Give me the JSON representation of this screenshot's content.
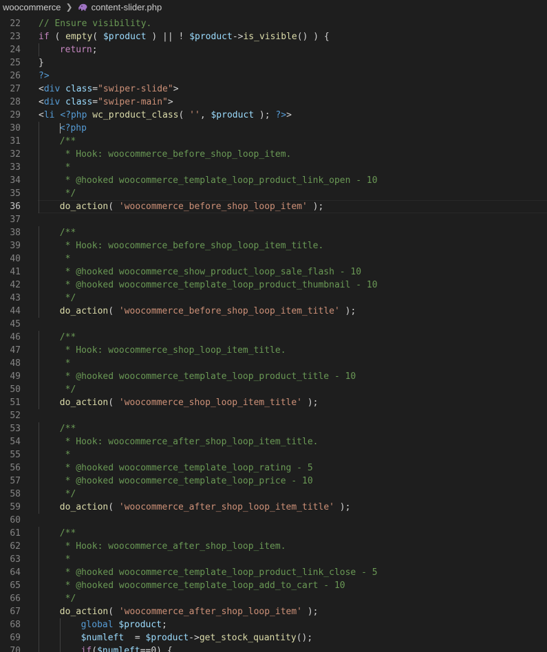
{
  "breadcrumb": {
    "folder": "woocommerce",
    "file": "content-slider.php",
    "file_icon": "php-elephant-icon"
  },
  "colors": {
    "background": "#1e1e1e",
    "comment": "#6a9955",
    "keyword": "#c586c0",
    "variable": "#9cdcfe",
    "function": "#dcdcaa",
    "string": "#ce9178",
    "tag": "#569cd6",
    "plain": "#d4d4d4"
  },
  "editor": {
    "current_line": 36,
    "lines": [
      {
        "n": "22",
        "indent": 0,
        "tokens": [
          [
            "c",
            "// Ensure visibility."
          ]
        ]
      },
      {
        "n": "23",
        "indent": 0,
        "tokens": [
          [
            "k",
            "if"
          ],
          [
            "p",
            " ( "
          ],
          [
            "f",
            "empty"
          ],
          [
            "p",
            "( "
          ],
          [
            "v",
            "$product"
          ],
          [
            "p",
            " ) || ! "
          ],
          [
            "v",
            "$product"
          ],
          [
            "p",
            "->"
          ],
          [
            "f",
            "is_visible"
          ],
          [
            "p",
            "() ) {"
          ]
        ]
      },
      {
        "n": "24",
        "indent": 1,
        "tokens": [
          [
            "k",
            "return"
          ],
          [
            "p",
            ";"
          ]
        ]
      },
      {
        "n": "25",
        "indent": 0,
        "tokens": [
          [
            "p",
            "}"
          ]
        ]
      },
      {
        "n": "26",
        "indent": 0,
        "tokens": [
          [
            "t",
            "?>"
          ]
        ]
      },
      {
        "n": "27",
        "indent": 0,
        "tokens": [
          [
            "p",
            "<"
          ],
          [
            "t",
            "div"
          ],
          [
            "p",
            " "
          ],
          [
            "a",
            "class"
          ],
          [
            "p",
            "="
          ],
          [
            "s",
            "\"swiper-slide\""
          ],
          [
            "p",
            ">"
          ]
        ]
      },
      {
        "n": "28",
        "indent": 0,
        "tokens": [
          [
            "p",
            "<"
          ],
          [
            "t",
            "div"
          ],
          [
            "p",
            " "
          ],
          [
            "a",
            "class"
          ],
          [
            "p",
            "="
          ],
          [
            "s",
            "\"swiper-main\""
          ],
          [
            "p",
            ">"
          ]
        ]
      },
      {
        "n": "29",
        "indent": 0,
        "tokens": [
          [
            "p",
            "<"
          ],
          [
            "t",
            "li"
          ],
          [
            "p",
            " "
          ],
          [
            "t",
            "<?php"
          ],
          [
            "p",
            " "
          ],
          [
            "f",
            "wc_product_class"
          ],
          [
            "p",
            "( "
          ],
          [
            "s",
            "''"
          ],
          [
            "p",
            ", "
          ],
          [
            "v",
            "$product"
          ],
          [
            "p",
            " ); "
          ],
          [
            "t",
            "?>"
          ],
          [
            "p",
            ">"
          ]
        ]
      },
      {
        "n": "30",
        "indent": 1,
        "tokens": [
          [
            "t",
            "<?php"
          ]
        ]
      },
      {
        "n": "31",
        "indent": 1,
        "tokens": [
          [
            "c",
            "/**"
          ]
        ]
      },
      {
        "n": "32",
        "indent": 1,
        "tokens": [
          [
            "c",
            " * Hook: woocommerce_before_shop_loop_item."
          ]
        ]
      },
      {
        "n": "33",
        "indent": 1,
        "tokens": [
          [
            "c",
            " *"
          ]
        ]
      },
      {
        "n": "34",
        "indent": 1,
        "tokens": [
          [
            "c",
            " * @hooked woocommerce_template_loop_product_link_open - 10"
          ]
        ]
      },
      {
        "n": "35",
        "indent": 1,
        "tokens": [
          [
            "c",
            " */"
          ]
        ]
      },
      {
        "n": "36",
        "indent": 1,
        "tokens": [
          [
            "f",
            "do_action"
          ],
          [
            "p",
            "( "
          ],
          [
            "s",
            "'woocommerce_before_shop_loop_item'"
          ],
          [
            "p",
            " );"
          ]
        ]
      },
      {
        "n": "37",
        "indent": 0,
        "tokens": []
      },
      {
        "n": "38",
        "indent": 1,
        "tokens": [
          [
            "c",
            "/**"
          ]
        ]
      },
      {
        "n": "39",
        "indent": 1,
        "tokens": [
          [
            "c",
            " * Hook: woocommerce_before_shop_loop_item_title."
          ]
        ]
      },
      {
        "n": "40",
        "indent": 1,
        "tokens": [
          [
            "c",
            " *"
          ]
        ]
      },
      {
        "n": "41",
        "indent": 1,
        "tokens": [
          [
            "c",
            " * @hooked woocommerce_show_product_loop_sale_flash - 10"
          ]
        ]
      },
      {
        "n": "42",
        "indent": 1,
        "tokens": [
          [
            "c",
            " * @hooked woocommerce_template_loop_product_thumbnail - 10"
          ]
        ]
      },
      {
        "n": "43",
        "indent": 1,
        "tokens": [
          [
            "c",
            " */"
          ]
        ]
      },
      {
        "n": "44",
        "indent": 1,
        "tokens": [
          [
            "f",
            "do_action"
          ],
          [
            "p",
            "( "
          ],
          [
            "s",
            "'woocommerce_before_shop_loop_item_title'"
          ],
          [
            "p",
            " );"
          ]
        ]
      },
      {
        "n": "45",
        "indent": 0,
        "tokens": []
      },
      {
        "n": "46",
        "indent": 1,
        "tokens": [
          [
            "c",
            "/**"
          ]
        ]
      },
      {
        "n": "47",
        "indent": 1,
        "tokens": [
          [
            "c",
            " * Hook: woocommerce_shop_loop_item_title."
          ]
        ]
      },
      {
        "n": "48",
        "indent": 1,
        "tokens": [
          [
            "c",
            " *"
          ]
        ]
      },
      {
        "n": "49",
        "indent": 1,
        "tokens": [
          [
            "c",
            " * @hooked woocommerce_template_loop_product_title - 10"
          ]
        ]
      },
      {
        "n": "50",
        "indent": 1,
        "tokens": [
          [
            "c",
            " */"
          ]
        ]
      },
      {
        "n": "51",
        "indent": 1,
        "tokens": [
          [
            "f",
            "do_action"
          ],
          [
            "p",
            "( "
          ],
          [
            "s",
            "'woocommerce_shop_loop_item_title'"
          ],
          [
            "p",
            " );"
          ]
        ]
      },
      {
        "n": "52",
        "indent": 0,
        "tokens": []
      },
      {
        "n": "53",
        "indent": 1,
        "tokens": [
          [
            "c",
            "/**"
          ]
        ]
      },
      {
        "n": "54",
        "indent": 1,
        "tokens": [
          [
            "c",
            " * Hook: woocommerce_after_shop_loop_item_title."
          ]
        ]
      },
      {
        "n": "55",
        "indent": 1,
        "tokens": [
          [
            "c",
            " *"
          ]
        ]
      },
      {
        "n": "56",
        "indent": 1,
        "tokens": [
          [
            "c",
            " * @hooked woocommerce_template_loop_rating - 5"
          ]
        ]
      },
      {
        "n": "57",
        "indent": 1,
        "tokens": [
          [
            "c",
            " * @hooked woocommerce_template_loop_price - 10"
          ]
        ]
      },
      {
        "n": "58",
        "indent": 1,
        "tokens": [
          [
            "c",
            " */"
          ]
        ]
      },
      {
        "n": "59",
        "indent": 1,
        "tokens": [
          [
            "f",
            "do_action"
          ],
          [
            "p",
            "( "
          ],
          [
            "s",
            "'woocommerce_after_shop_loop_item_title'"
          ],
          [
            "p",
            " );"
          ]
        ]
      },
      {
        "n": "60",
        "indent": 0,
        "tokens": []
      },
      {
        "n": "61",
        "indent": 1,
        "tokens": [
          [
            "c",
            "/**"
          ]
        ]
      },
      {
        "n": "62",
        "indent": 1,
        "tokens": [
          [
            "c",
            " * Hook: woocommerce_after_shop_loop_item."
          ]
        ]
      },
      {
        "n": "63",
        "indent": 1,
        "tokens": [
          [
            "c",
            " *"
          ]
        ]
      },
      {
        "n": "64",
        "indent": 1,
        "tokens": [
          [
            "c",
            " * @hooked woocommerce_template_loop_product_link_close - 5"
          ]
        ]
      },
      {
        "n": "65",
        "indent": 1,
        "tokens": [
          [
            "c",
            " * @hooked woocommerce_template_loop_add_to_cart - 10"
          ]
        ]
      },
      {
        "n": "66",
        "indent": 1,
        "tokens": [
          [
            "c",
            " */"
          ]
        ]
      },
      {
        "n": "67",
        "indent": 1,
        "tokens": [
          [
            "f",
            "do_action"
          ],
          [
            "p",
            "( "
          ],
          [
            "s",
            "'woocommerce_after_shop_loop_item'"
          ],
          [
            "p",
            " );"
          ]
        ]
      },
      {
        "n": "68",
        "indent": 2,
        "tokens": [
          [
            "k2",
            "global"
          ],
          [
            "p",
            " "
          ],
          [
            "v",
            "$product"
          ],
          [
            "p",
            ";"
          ]
        ]
      },
      {
        "n": "69",
        "indent": 2,
        "tokens": [
          [
            "v",
            "$numleft"
          ],
          [
            "p",
            "  = "
          ],
          [
            "v",
            "$product"
          ],
          [
            "p",
            "->"
          ],
          [
            "f",
            "get_stock_quantity"
          ],
          [
            "p",
            "();"
          ]
        ]
      },
      {
        "n": "70",
        "indent": 2,
        "tokens": [
          [
            "k",
            "if"
          ],
          [
            "p",
            "("
          ],
          [
            "v",
            "$numleft"
          ],
          [
            "p",
            "==0) {"
          ]
        ]
      }
    ]
  }
}
